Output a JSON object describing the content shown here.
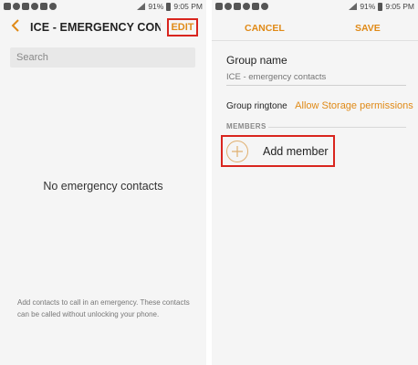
{
  "status_bar": {
    "battery": "91%",
    "time": "9:05 PM"
  },
  "left_screen": {
    "title": "ICE - EMERGENCY CONTACTS",
    "edit_label": "EDIT",
    "search_placeholder": "Search",
    "empty_message": "No emergency contacts",
    "help_text": "Add contacts to call in an emergency. These contacts can be called without unlocking your phone."
  },
  "right_screen": {
    "cancel_label": "CANCEL",
    "save_label": "SAVE",
    "group_name_label": "Group name",
    "group_name_placeholder": "ICE - emergency contacts",
    "ringtone_label": "Group ringtone",
    "ringtone_value": "Allow Storage permissions",
    "members_header": "MEMBERS",
    "add_member_label": "Add member"
  },
  "colors": {
    "accent": "#e08a17",
    "highlight": "#d9251e"
  },
  "icons": [
    "back-arrow-icon",
    "plus-icon",
    "signal-icon",
    "battery-icon"
  ]
}
